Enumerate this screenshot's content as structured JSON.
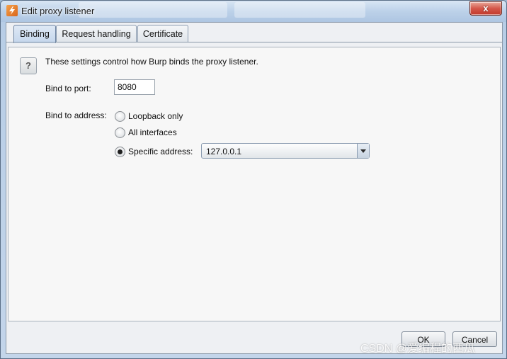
{
  "window": {
    "title": "Edit proxy listener",
    "close_glyph": "x"
  },
  "tabs": [
    {
      "label": "Binding",
      "active": true
    },
    {
      "label": "Request handling",
      "active": false
    },
    {
      "label": "Certificate",
      "active": false
    }
  ],
  "binding": {
    "help_glyph": "?",
    "description": "These settings control how Burp binds the proxy listener.",
    "port_label": "Bind to port:",
    "port_value": "8080",
    "address_label": "Bind to address:",
    "options": [
      {
        "label": "Loopback only",
        "checked": false
      },
      {
        "label": "All interfaces",
        "checked": false
      },
      {
        "label": "Specific address:",
        "checked": true
      }
    ],
    "specific_address_value": "127.0.0.1"
  },
  "footer": {
    "ok_label": "OK",
    "cancel_label": "Cancel"
  },
  "watermark": "CSDN @爱编程的西瓜"
}
